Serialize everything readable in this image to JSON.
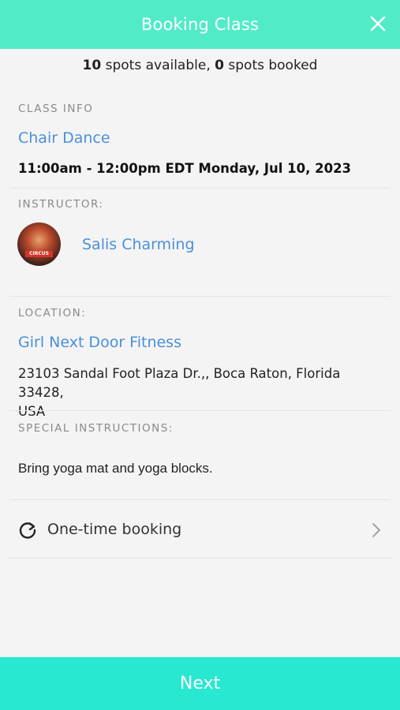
{
  "header": {
    "title": "Booking Class",
    "close_icon": "close-icon"
  },
  "availability": {
    "available_count": "10",
    "available_text": "spots available,",
    "booked_count": "0",
    "booked_text": "spots booked"
  },
  "class_info": {
    "label": "CLASS INFO",
    "name": "Chair Dance",
    "datetime": "11:00am - 12:00pm EDT Monday, Jul 10, 2023"
  },
  "instructor": {
    "label": "INSTRUCTOR:",
    "name": "Salis Charming",
    "avatar_text": "CIRCUS"
  },
  "location": {
    "label": "LOCATION:",
    "name": "Girl Next Door Fitness",
    "address_line1": "23103 Sandal Foot Plaza Dr.,, Boca Raton, Florida 33428,",
    "address_line2": "USA"
  },
  "special": {
    "label": "SPECIAL INSTRUCTIONS:",
    "text": "Bring yoga mat and yoga blocks."
  },
  "booking": {
    "label": "One-time booking",
    "icon": "refresh-icon"
  },
  "footer": {
    "next_label": "Next"
  },
  "colors": {
    "header": "#52ebc8",
    "footer": "#28e8d1",
    "link": "#4a90d9"
  }
}
